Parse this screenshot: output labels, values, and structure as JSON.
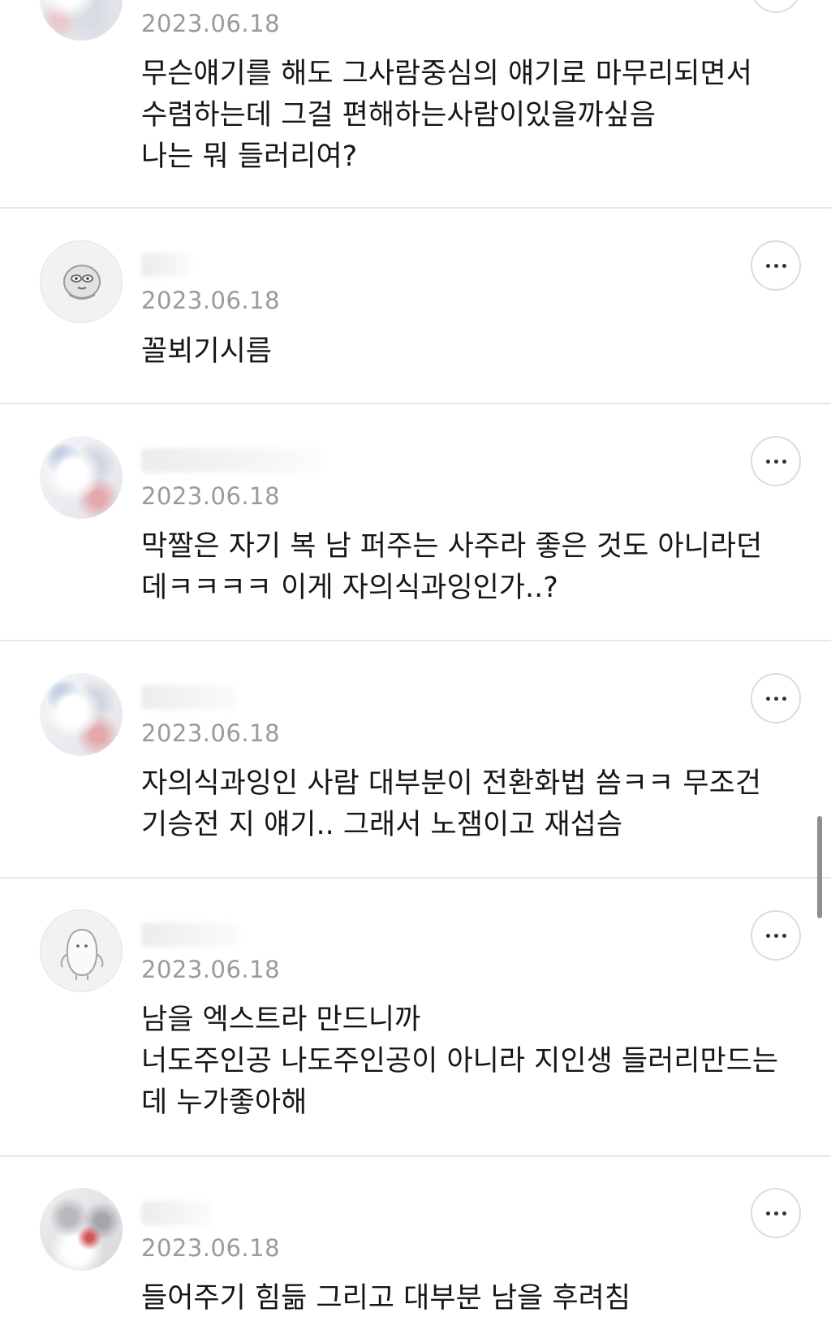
{
  "comments": [
    {
      "date": "2023.06.18",
      "text": "무슨얘기를 해도 그사람중심의 얘기로 마무리되면서\n수렴하는데 그걸 편해하는사람이있을까싶음\n나는 뭐 들러리여?"
    },
    {
      "date": "2023.06.18",
      "text": "꼴뵈기시름"
    },
    {
      "date": "2023.06.18",
      "text": "막짤은 자기 복 남 퍼주는 사주라 좋은 것도 아니라던\n데ㅋㅋㅋㅋ 이게 자의식과잉인가..?"
    },
    {
      "date": "2023.06.18",
      "text": "자의식과잉인 사람 대부분이 전환화법 씀ㅋㅋ 무조건\n기승전 지 얘기.. 그래서 노잼이고 재섭슴"
    },
    {
      "date": "2023.06.18",
      "text": "남을 엑스트라 만드니까\n너도주인공 나도주인공이 아니라 지인생 들러리만드는\n데 누가좋아해"
    },
    {
      "date": "2023.06.18",
      "text": "들어주기 힘듦 그리고 대부분 남을 후려침"
    }
  ],
  "icons": {
    "more": "more-horizontal-icon",
    "avatar": "avatar-icon"
  },
  "colors": {
    "date": "#9a9a9a",
    "divider": "#e6e6e6",
    "text": "#161616"
  }
}
